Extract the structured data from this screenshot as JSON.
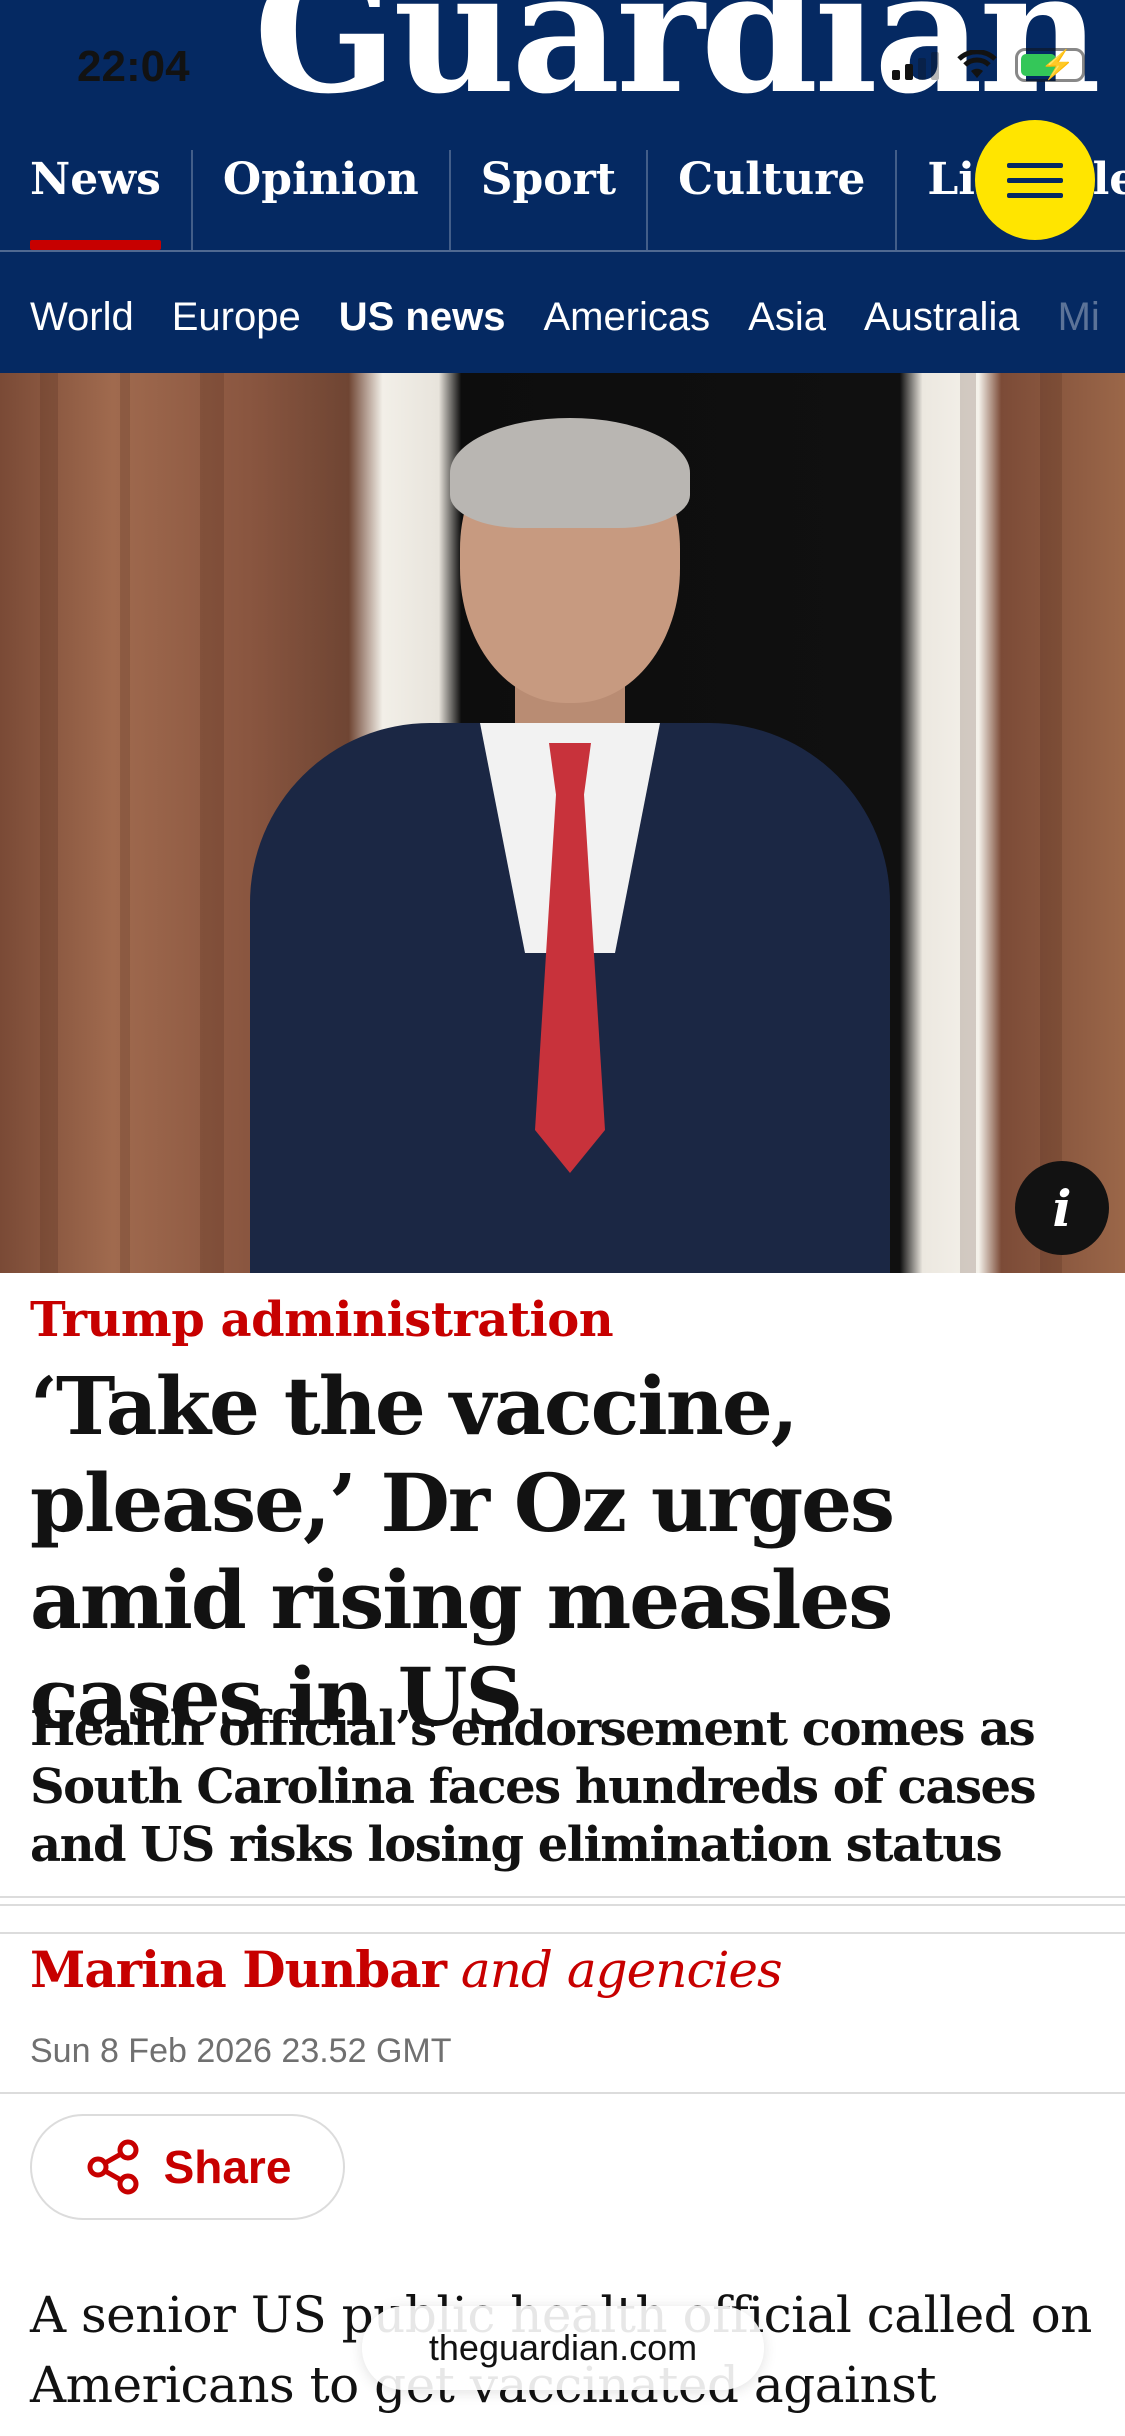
{
  "status_bar": {
    "time": "22:04"
  },
  "header": {
    "logo": "Guardian",
    "pillars": [
      {
        "label": "News",
        "active": true
      },
      {
        "label": "Opinion",
        "active": false
      },
      {
        "label": "Sport",
        "active": false
      },
      {
        "label": "Culture",
        "active": false
      },
      {
        "label": "Lifestyle",
        "active": false
      }
    ],
    "menu_icon": "hamburger-menu-icon",
    "subnav": [
      {
        "label": "World"
      },
      {
        "label": "Europe"
      },
      {
        "label": "US news",
        "current": true
      },
      {
        "label": "Americas"
      },
      {
        "label": "Asia"
      },
      {
        "label": "Australia"
      },
      {
        "label": "Mi"
      }
    ]
  },
  "hero": {
    "info_label": "i"
  },
  "article": {
    "kicker": "Trump administration",
    "headline": "‘Take the vaccine, please,’ Dr Oz urges amid rising measles cases in US",
    "standfirst": "Health official’s endorsement comes as South Carolina faces hundreds of cases and US risks losing elimination status",
    "byline_author": "Marina Dunbar",
    "byline_suffix": "and agencies",
    "date": "Sun 8 Feb 2026 23.52 GMT",
    "share_label": "Share",
    "body_line1": "A senior US public health official called on",
    "body_line2": "Americans to get vaccinated against"
  },
  "browser": {
    "url": "theguardian.com"
  },
  "colors": {
    "brand_blue": "#052962",
    "accent_red": "#c70000",
    "menu_yellow": "#ffe500"
  }
}
